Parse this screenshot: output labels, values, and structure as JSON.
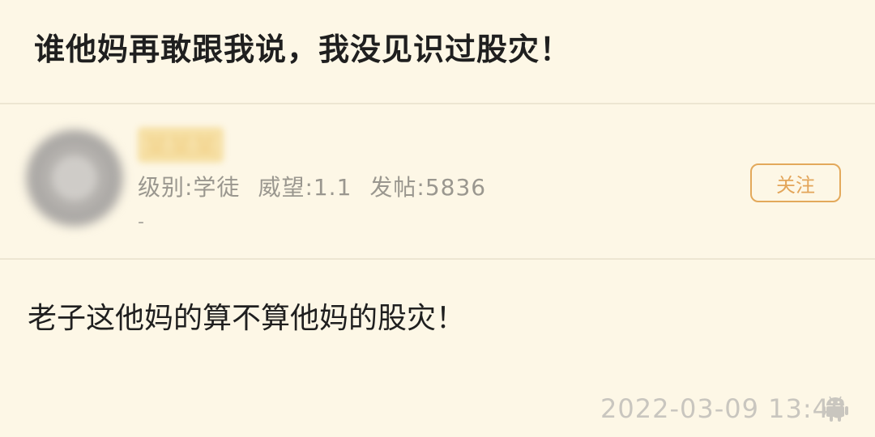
{
  "post": {
    "title": "谁他妈再敢跟我说，我没见识过股灾！"
  },
  "author": {
    "name": "某某某",
    "level": "级别:学徒",
    "reputation": "威望:1.1",
    "posts": "发帖:5836",
    "signature": "-",
    "follow_label": "关注"
  },
  "reply": {
    "content": "老子这他妈的算不算他妈的股灾！",
    "timestamp": "2022-03-09 13:48",
    "device_icon": "android-icon"
  },
  "colors": {
    "background": "#fdf7e6",
    "accent": "#e3a95b"
  }
}
